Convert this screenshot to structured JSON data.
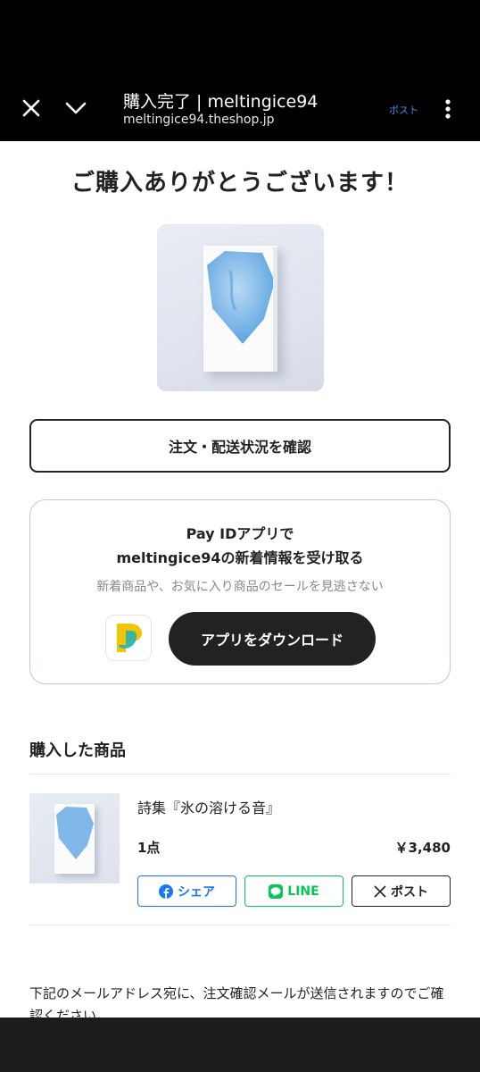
{
  "browser": {
    "title": "購入完了 | meltingice94",
    "url": "meltingice94.theshop.jp",
    "post_link": "ポスト"
  },
  "page": {
    "thanks_heading": "ご購入ありがとうございます！",
    "order_status_button": "注文・配送状況を確認"
  },
  "payid": {
    "line1": "Pay IDアプリで",
    "line2": "meltingice94の新着情報を受け取る",
    "subtitle": "新着商品や、お気に入り商品のセールを見逃さない",
    "download_button": "アプリをダウンロード",
    "logo_colors": [
      "#f5c400",
      "#2ab5ad"
    ]
  },
  "purchased": {
    "section_title": "購入した商品",
    "items": [
      {
        "name": "詩集『氷の溶ける音』",
        "quantity": "1点",
        "price": "￥3,480"
      }
    ]
  },
  "share": {
    "facebook_label": "シェア",
    "line_label": "LINE",
    "x_label": "ポスト",
    "facebook_color": "#1877f2",
    "line_color": "#06c755"
  },
  "email_note": "下記のメールアドレス宛に、注文確認メールが送信されますのでご確認ください。"
}
